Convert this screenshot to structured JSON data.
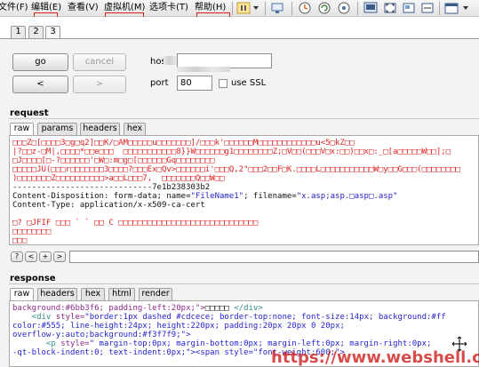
{
  "menubar": {
    "items": [
      {
        "name": "menu-file",
        "label": "文件(F)"
      },
      {
        "name": "menu-edit",
        "label": "编辑(E)"
      },
      {
        "name": "menu-view",
        "label": "查看(V)"
      },
      {
        "name": "menu-vm",
        "label": "虚拟机(M)"
      },
      {
        "name": "menu-tabs",
        "label": "选项卡(T)"
      },
      {
        "name": "menu-help",
        "label": "帮助(H)"
      }
    ]
  },
  "tabs": [
    "1",
    "2",
    "3"
  ],
  "active_tab": "3",
  "controls": {
    "go_label": "go",
    "cancel_label": "cancel",
    "back_label": "<",
    "forward_label": ">",
    "host_label": "hos",
    "port_label": "port",
    "port_value": "80",
    "ssl_label": "use SSL"
  },
  "request": {
    "title": "request",
    "tabs": [
      "raw",
      "params",
      "headers",
      "hex"
    ],
    "active_tab": "raw",
    "lines": [
      {
        "cls": "red",
        "text": "□□□Z□[□□□□3□g□q2]□□K/□AM□□□□□u□□□□□□□]/□□□k'□□□□□□M□□□□□□□□□□□□u<5□kZ□□"
      },
      {
        "cls": "red",
        "text": "|?□□z-□M|,□□□□*□□e□□□  □□□□□□□□□□□8}}W□□□□□□g1□□□□□□□□Z;□V□□(□□□V□x:□□)□□x□:_□[a□□□□□W□□];□"
      },
      {
        "cls": "red",
        "text": "□J□□□□[□-?□□□□□□'□W□:m□g□[□□□□□□Gq□□□□□□□□"
      },
      {
        "cls": "red",
        "text": "□□□□□JU(□□□r□□□□□□□3□□□□?□□□Ex□Qv>□□□□□□i'□□□Q,2\"□□□2□□F□K.□□□□L□□□□□□□□□□□W□y□□G□□□(□□□□□□□□"
      },
      {
        "cls": "red",
        "text": ")□□□□□□□Z□□□□□□□□□□>a□□L□□□7,  □□□□□□□Q□□W□□"
      },
      {
        "cls": "blk",
        "text": "-----------------------------7e1b238303b2"
      },
      {
        "cls": "multi",
        "parts": [
          {
            "cls": "blk",
            "text": "Content-Disposition: form-data; name="
          },
          {
            "cls": "blue",
            "text": "\"FileName1\""
          },
          {
            "cls": "blk",
            "text": "; filename="
          },
          {
            "cls": "blue",
            "text": "\"x.asp;asp.□asp□.asp\""
          }
        ]
      },
      {
        "cls": "blk",
        "text": "Content-Type: application/x-x509-ca-cert"
      },
      {
        "cls": "blk",
        "text": ""
      },
      {
        "cls": "red",
        "text": "□? □JFIF □□□ ` ` □□ C □□□□□□□□□□□□□□□□□□□□□□□□□□□□□"
      },
      {
        "cls": "red",
        "text": "□□□□□□□□"
      },
      {
        "cls": "red",
        "text": "□□□"
      }
    ],
    "nav_buttons": [
      "?",
      "<",
      "+",
      ">"
    ]
  },
  "response": {
    "title": "response",
    "tabs": [
      "raw",
      "headers",
      "hex",
      "html",
      "render"
    ],
    "active_tab": "raw",
    "lines": [
      {
        "parts": [
          {
            "cls": "purple",
            "text": "background:#6bb3f6; padding-left:20px;\">"
          },
          {
            "cls": "blk",
            "text": "□□□□□ "
          },
          {
            "cls": "teal",
            "text": "</div>"
          }
        ]
      },
      {
        "parts": [
          {
            "cls": "teal",
            "text": "    <div "
          },
          {
            "cls": "purple",
            "text": "style="
          },
          {
            "cls": "blue",
            "text": "\"border:1px dashed #cdcece; border-top:none; font-size:14px; background:#ff"
          }
        ]
      },
      {
        "parts": [
          {
            "cls": "blue",
            "text": "color:#555; line-height:24px; height:220px; padding:20px 20px 0 20px;"
          }
        ]
      },
      {
        "parts": [
          {
            "cls": "blue",
            "text": "overflow-y:auto;background:#f3f7f9;\">"
          }
        ]
      },
      {
        "parts": [
          {
            "cls": "teal",
            "text": "       <p "
          },
          {
            "cls": "purple",
            "text": "style="
          },
          {
            "cls": "blue",
            "text": "\" margin-top:0px; margin-bottom:0px; margin-left:0px; margin-right:0px;"
          }
        ]
      },
      {
        "parts": [
          {
            "cls": "blue",
            "text": "-qt-block-indent:0; text-indent:0px;\"><span style=\"font-weight:600;\">"
          }
        ]
      }
    ]
  },
  "watermark": {
    "text": "https://www.webshell.cn"
  }
}
